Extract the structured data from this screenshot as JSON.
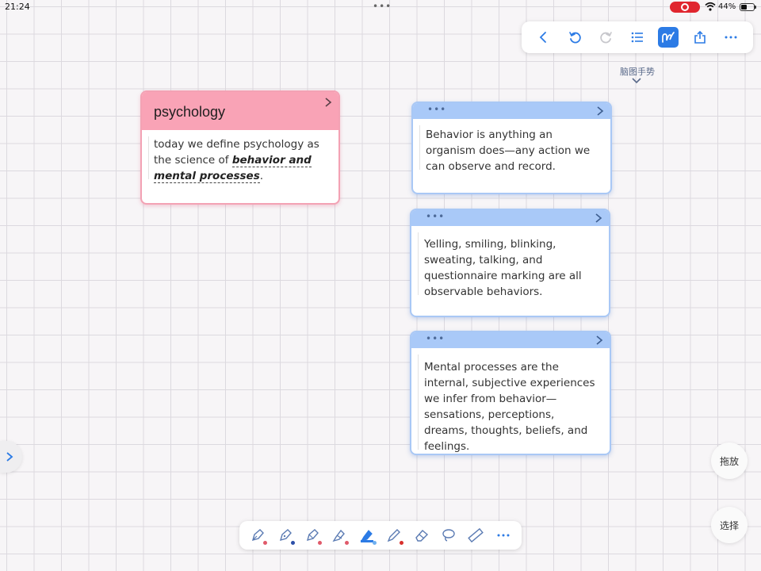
{
  "status_bar": {
    "time": "21:24",
    "battery": "44%"
  },
  "toolbar": {
    "items": [
      "back",
      "undo",
      "redo",
      "list",
      "lasso-gesture",
      "share",
      "more"
    ],
    "active": "lasso-gesture",
    "accent": "#2c7be5"
  },
  "gesture_label": "脑图手势",
  "cards": [
    {
      "title": "psychology",
      "body_prefix": "today we define psychology as the science of ",
      "body_highlight": "behavior and mental processes",
      "body_suffix": ".",
      "color": "#f9a3b6"
    },
    {
      "body": "Behavior is anything an organism does—any action we can observe and record.",
      "color": "#a9c9f8"
    },
    {
      "body": "Yelling, smiling, blinking, sweating, talking, and questionnaire marking are all observable behaviors.",
      "color": "#a9c9f8"
    },
    {
      "body": "Mental processes are the internal, subjective experiences we infer from behavior—sensations, perceptions, dreams, thoughts, beliefs, and feelings.",
      "color": "#a9c9f8"
    }
  ],
  "card_header_dots": "•••",
  "right_buttons": {
    "drag": "拖放",
    "select": "选择"
  },
  "bottom_tools": [
    {
      "icon": "fountain-pen-icon",
      "dot": "#e05a6a"
    },
    {
      "icon": "ballpoint-pen-icon",
      "dot": "#2c4fa8"
    },
    {
      "icon": "pen-icon",
      "dot": "#e05a6a"
    },
    {
      "icon": "highlighter-icon",
      "dot": "#e05a6a"
    },
    {
      "icon": "highlighter-blue-icon",
      "dot": "#6fb0f0"
    },
    {
      "icon": "pencil-icon",
      "dot": "#d8302c"
    },
    {
      "icon": "eraser-icon"
    },
    {
      "icon": "lasso-icon"
    },
    {
      "icon": "ruler-icon"
    },
    {
      "icon": "more-icon"
    }
  ]
}
